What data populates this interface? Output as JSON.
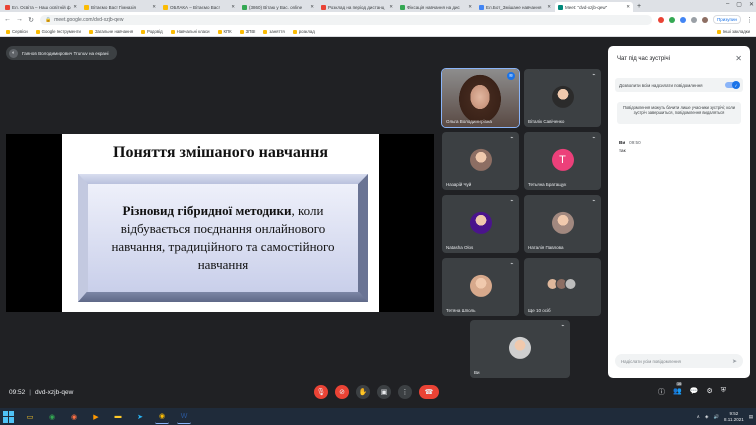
{
  "browser": {
    "tabs": [
      {
        "label": "Ел. Освіта – Наш освітній ф",
        "color": "#ea4335",
        "active": false
      },
      {
        "label": "Вітаємо Вас! Гімназія",
        "color": "#fbbc04",
        "active": false
      },
      {
        "label": "ОБЛАКА – Вітаємо Вас!",
        "color": "#fbbc04",
        "active": false
      },
      {
        "label": "(3860) Вітаю у Вас. online",
        "color": "#34a853",
        "active": false
      },
      {
        "label": "Розклад на період дистанц",
        "color": "#ea4335",
        "active": false
      },
      {
        "label": "Фіксація навчання на дис",
        "color": "#34a853",
        "active": false
      },
      {
        "label": "Ел.Бот_Змішане навчання",
        "color": "#4285f4",
        "active": false
      },
      {
        "label": "Meet: \"dvd-xzjb-qew\"",
        "color": "#00897b",
        "active": true
      }
    ],
    "url": "meet.google.com/dvd-xzjb-qew",
    "pause_label": "Призупин",
    "bookmarks": [
      "Сервіси",
      "Google Інструменти",
      "Загальне навчання",
      "Родовід",
      "Навчальні класи",
      "КПК",
      "ЗПВІ",
      "заняття",
      "розклад"
    ],
    "bookmarks_right": "Інші закладки"
  },
  "meet": {
    "presenter_label": "Гаянов Володимирович Trunuv на екрані",
    "slide": {
      "title": "Поняття змішаного навчання",
      "body_bold": "Різновид гібридної методики",
      "body_rest": ", коли відбувається поєднання онлайнового навчання, традиційного та самостійного навчання"
    },
    "participants": [
      {
        "name": "Ольга Володимирівна",
        "type": "video",
        "speaking": true,
        "icon": "speaking-icon"
      },
      {
        "name": "Віталік Савіченко",
        "type": "photo",
        "color": "#2b2b2b"
      },
      {
        "name": "Назарій Чуй",
        "type": "photo",
        "color": "#8d6e63"
      },
      {
        "name": "Тетьяна Братащук",
        "type": "letter",
        "letter": "Т",
        "color": "#ec407a"
      },
      {
        "name": "Natasha Olos",
        "type": "photo",
        "color": "#4a148c"
      },
      {
        "name": "Наталія Павлова",
        "type": "photo",
        "color": "#a1887f"
      },
      {
        "name": "Тетяна Шполь",
        "type": "photo",
        "color": "#d7a98c"
      },
      {
        "name": "Ще 10 осіб",
        "type": "group"
      },
      {
        "name": "Ви",
        "type": "photo",
        "color": "#cfcfcf"
      }
    ],
    "time": "09:52",
    "meeting_code": "dvd-xzjb-qew",
    "participant_count": "16"
  },
  "chat": {
    "title": "Чат під час зустрічі",
    "toggle_label": "Дозволити всім надсилати повідомлення",
    "toggle_on": true,
    "notice": "Повідомлення можуть бачити лише учасники зустрічі; коли зустріч завершиться, повідомлення видаляться",
    "messages": [
      {
        "sender": "Ви",
        "time": "09:50",
        "text": "так"
      }
    ],
    "input_placeholder": "Надіслати усім повідомлення"
  },
  "taskbar": {
    "apps": [
      {
        "icon": "explorer-icon",
        "glyph": "▭",
        "color": "#ffca28"
      },
      {
        "icon": "chrome-icon",
        "glyph": "◉",
        "color": "#34a853"
      },
      {
        "icon": "firefox-icon",
        "glyph": "◉",
        "color": "#ff7043"
      },
      {
        "icon": "media-icon",
        "glyph": "▶",
        "color": "#ff9800"
      },
      {
        "icon": "folder-icon",
        "glyph": "▬",
        "color": "#ffca28"
      },
      {
        "icon": "telegram-icon",
        "glyph": "➤",
        "color": "#29b6f6"
      },
      {
        "icon": "chrome-active-icon",
        "glyph": "◉",
        "color": "#fbbc04"
      },
      {
        "icon": "word-icon",
        "glyph": "W",
        "color": "#2b579a"
      }
    ],
    "clock_time": "9:52",
    "clock_date": "8.11.2021"
  }
}
